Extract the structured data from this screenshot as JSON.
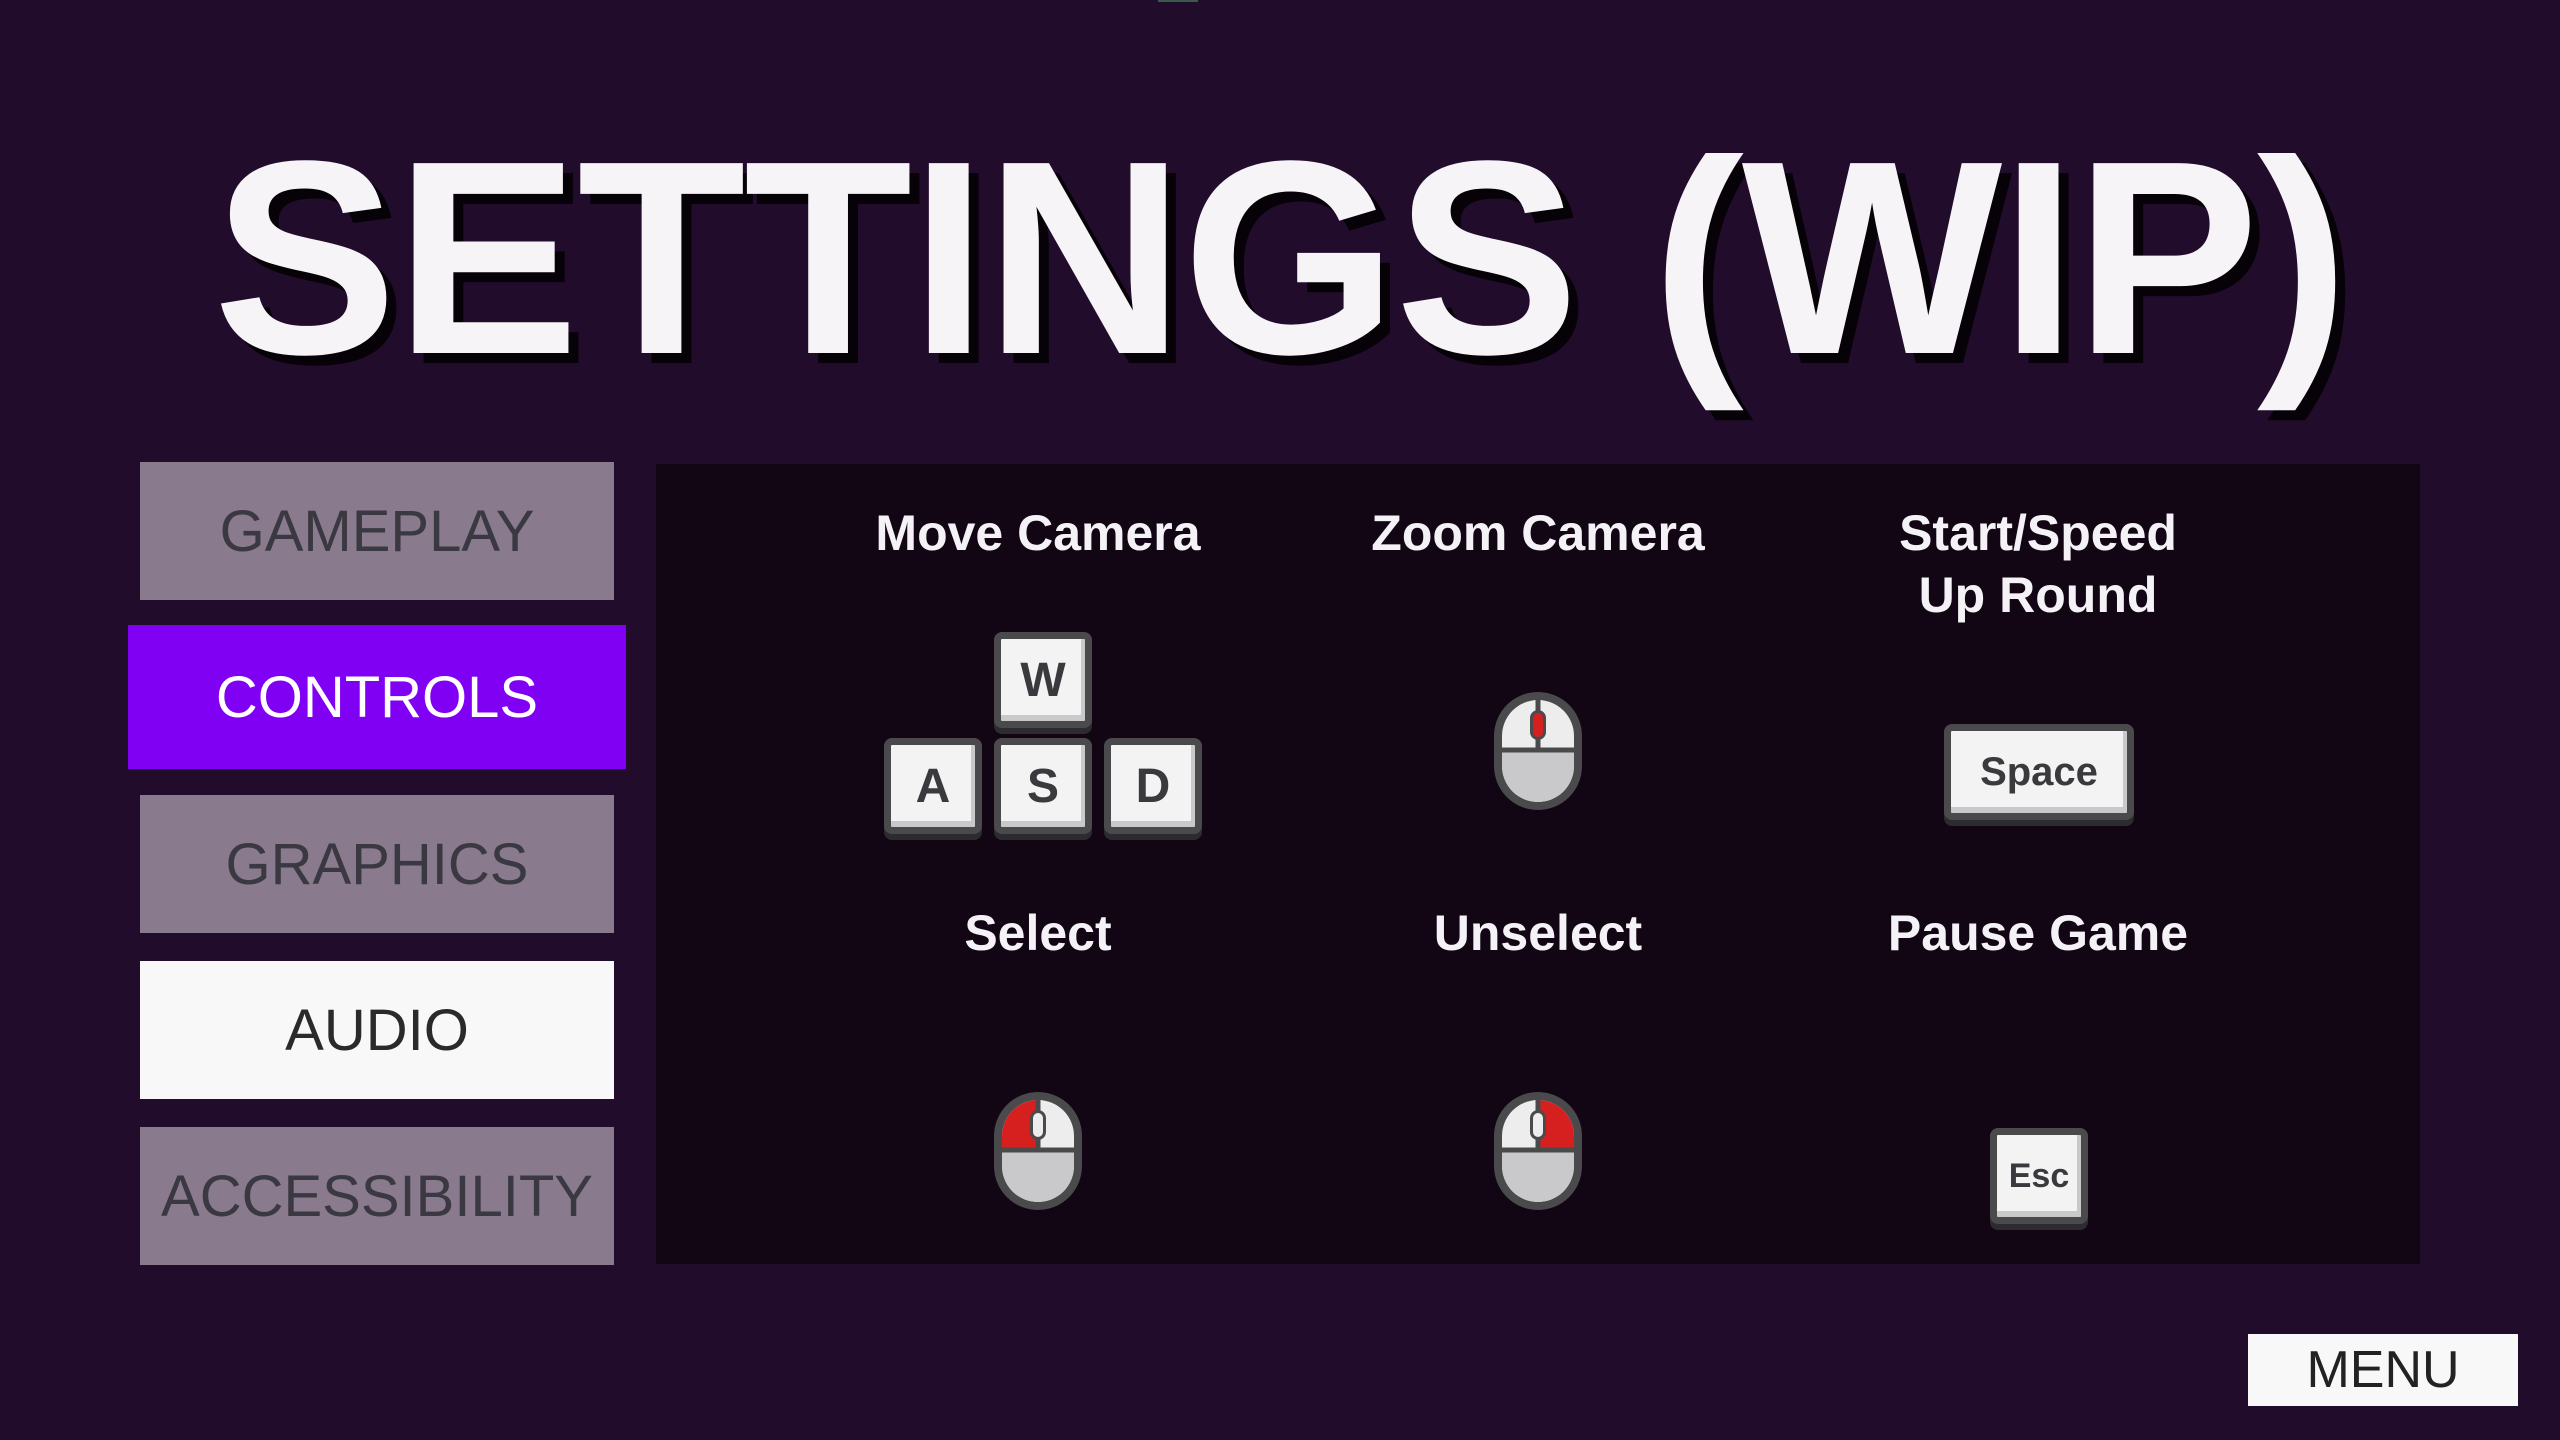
{
  "title": "SETTINGS (WIP)",
  "tabs": [
    {
      "label": "GAMEPLAY",
      "state": "default"
    },
    {
      "label": "CONTROLS",
      "state": "active"
    },
    {
      "label": "GRAPHICS",
      "state": "default"
    },
    {
      "label": "AUDIO",
      "state": "hover"
    },
    {
      "label": "ACCESSIBILITY",
      "state": "default"
    }
  ],
  "controls": [
    {
      "label": "Move Camera",
      "input": "wasd-keys",
      "keys": [
        "W",
        "A",
        "S",
        "D"
      ]
    },
    {
      "label": "Zoom Camera",
      "input": "mouse-wheel-icon"
    },
    {
      "label": "Start/Speed\nUp Round",
      "input": "key",
      "key": "Space"
    },
    {
      "label": "Select",
      "input": "mouse-left-click-icon"
    },
    {
      "label": "Unselect",
      "input": "mouse-right-click-icon"
    },
    {
      "label": "Pause Game",
      "input": "key",
      "key": "Esc"
    }
  ],
  "menu_button": "MENU",
  "colors": {
    "background": "#210c2c",
    "panel": "#120614",
    "tab_default": "#8a7a8e",
    "tab_active": "#8000f4",
    "tab_hover": "#f8f8f8",
    "mouse_highlight": "#d62020"
  }
}
